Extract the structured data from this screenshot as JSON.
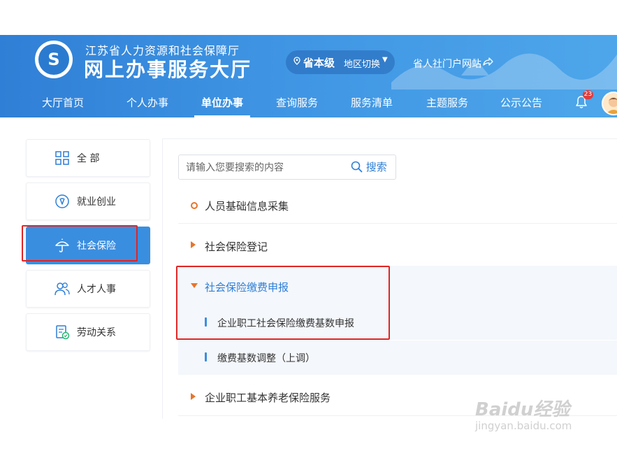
{
  "header": {
    "org_name": "江苏省人力资源和社会保障厅",
    "hall_title": "网上办事服务大厅",
    "region_level": "省本级",
    "region_switch": "地区切换",
    "portal_link": "省人社门户网站",
    "bell_badge": "23",
    "colors": {
      "primary": "#2f7fd6",
      "accent": "#e8742a",
      "highlight": "#e02525"
    }
  },
  "nav": {
    "items": [
      "大厅首页",
      "个人办事",
      "单位办事",
      "查询服务",
      "服务清单",
      "主题服务",
      "公示公告"
    ],
    "active": "单位办事"
  },
  "sidebar": {
    "items": [
      {
        "label": "全 部",
        "icon": "grid-icon"
      },
      {
        "label": "就业创业",
        "icon": "briefcase-icon"
      },
      {
        "label": "社会保险",
        "icon": "umbrella-icon",
        "active": true
      },
      {
        "label": "人才人事",
        "icon": "people-icon"
      },
      {
        "label": "劳动关系",
        "icon": "contract-icon"
      }
    ]
  },
  "search": {
    "placeholder": "请输入您要搜索的内容",
    "button": "搜索"
  },
  "services": {
    "items": [
      {
        "label": "人员基础信息采集",
        "marker": "circle"
      },
      {
        "label": "社会保险登记",
        "marker": "collapsed"
      },
      {
        "label": "社会保险缴费申报",
        "marker": "expanded",
        "children": [
          "企业职工社会保险缴费基数申报",
          "缴费基数调整（上调）"
        ]
      },
      {
        "label": "企业职工基本养老保险服务",
        "marker": "collapsed"
      }
    ]
  },
  "watermark": {
    "logo": "Baidu经验",
    "url": "jingyan.baidu.com"
  }
}
